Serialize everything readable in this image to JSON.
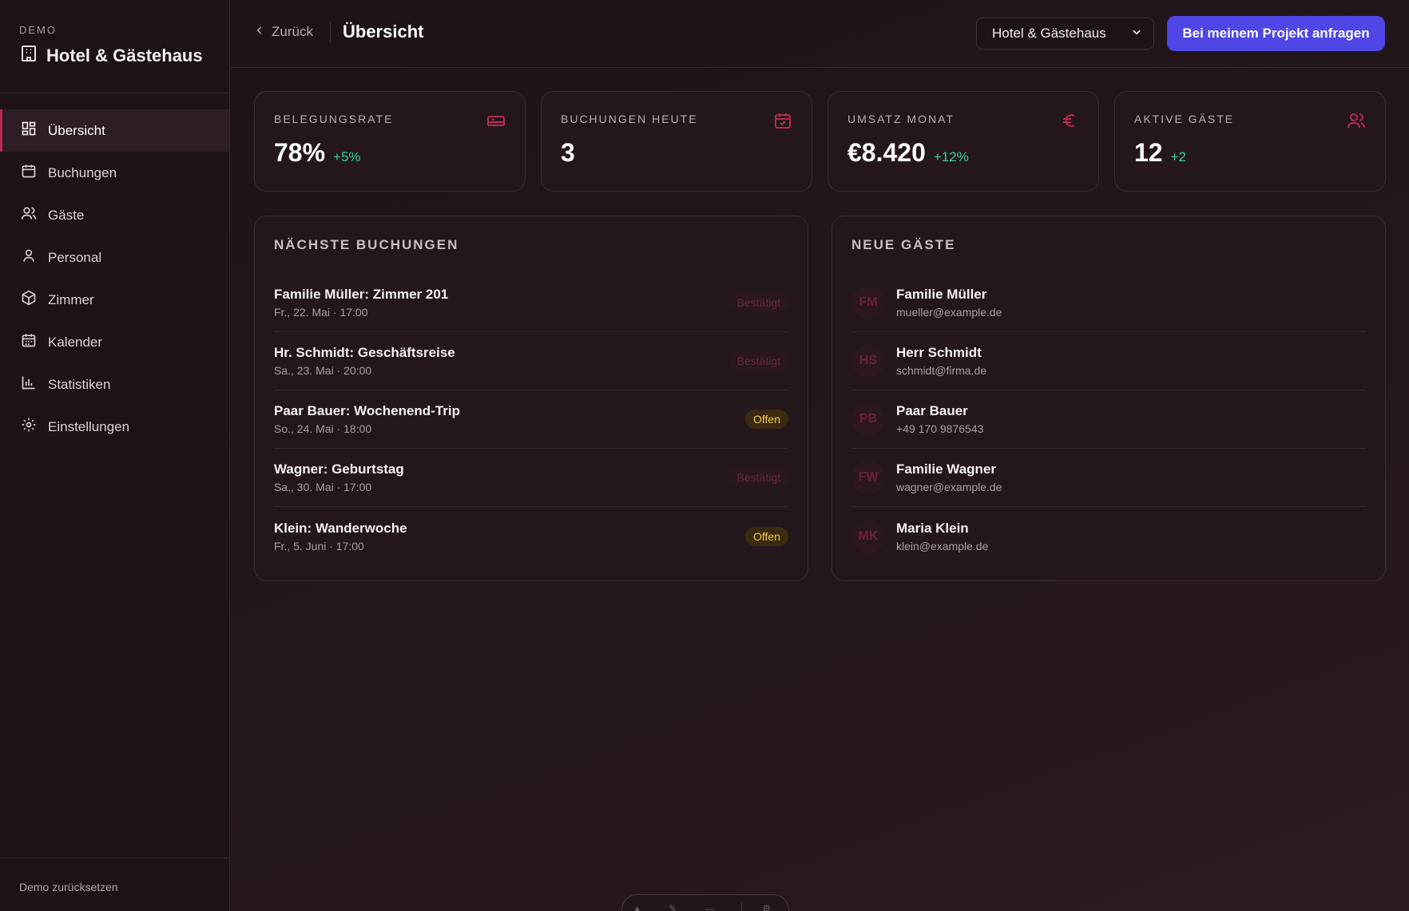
{
  "sidebar": {
    "demo_label": "DEMO",
    "title": "Hotel & Gästehaus",
    "items": [
      {
        "label": "Übersicht",
        "icon": "grid-icon"
      },
      {
        "label": "Buchungen",
        "icon": "calendar-icon"
      },
      {
        "label": "Gäste",
        "icon": "users-icon"
      },
      {
        "label": "Personal",
        "icon": "user-icon"
      },
      {
        "label": "Zimmer",
        "icon": "box-icon"
      },
      {
        "label": "Kalender",
        "icon": "calendar-grid-icon"
      },
      {
        "label": "Statistiken",
        "icon": "bar-chart-icon"
      },
      {
        "label": "Einstellungen",
        "icon": "gear-icon"
      }
    ],
    "footer": "Demo zurücksetzen"
  },
  "header": {
    "back_label": "Zurück",
    "title": "Übersicht",
    "select_value": "Hotel & Gästehaus",
    "cta_label": "Bei meinem Projekt anfragen"
  },
  "stats": [
    {
      "label": "BELEGUNGSRATE",
      "value": "78%",
      "delta": "+5%",
      "icon": "bed-icon"
    },
    {
      "label": "BUCHUNGEN HEUTE",
      "value": "3",
      "delta": "",
      "icon": "calendar-check-icon"
    },
    {
      "label": "UMSATZ MONAT",
      "value": "€8.420",
      "delta": "+12%",
      "icon": "euro-icon"
    },
    {
      "label": "AKTIVE GÄSTE",
      "value": "12",
      "delta": "+2",
      "icon": "users-icon"
    }
  ],
  "bookings": {
    "title": "NÄCHSTE BUCHUNGEN",
    "rows": [
      {
        "name": "Familie Müller: Zimmer 201",
        "when": "Fr., 22. Mai · 17:00",
        "status": "Bestätigt"
      },
      {
        "name": "Hr. Schmidt: Geschäftsreise",
        "when": "Sa., 23. Mai · 20:00",
        "status": "Bestätigt"
      },
      {
        "name": "Paar Bauer: Wochenend-Trip",
        "when": "So., 24. Mai · 18:00",
        "status": "Offen"
      },
      {
        "name": "Wagner: Geburtstag",
        "when": "Sa., 30. Mai · 17:00",
        "status": "Bestätigt"
      },
      {
        "name": "Klein: Wanderwoche",
        "when": "Fr., 5. Juni · 17:00",
        "status": "Offen"
      }
    ]
  },
  "guests": {
    "title": "NEUE GÄSTE",
    "rows": [
      {
        "initials": "FM",
        "name": "Familie Müller",
        "contact": "mueller@example.de"
      },
      {
        "initials": "HS",
        "name": "Herr Schmidt",
        "contact": "schmidt@firma.de"
      },
      {
        "initials": "PB",
        "name": "Paar Bauer",
        "contact": "+49 170 9876543"
      },
      {
        "initials": "FW",
        "name": "Familie Wagner",
        "contact": "wagner@example.de"
      },
      {
        "initials": "MK",
        "name": "Maria Klein",
        "contact": "klein@example.de"
      }
    ]
  },
  "colors": {
    "accent": "#4f46e5",
    "brand_red": "#b8294f",
    "positive": "#34d399",
    "open_badge": "#f2c94c"
  }
}
